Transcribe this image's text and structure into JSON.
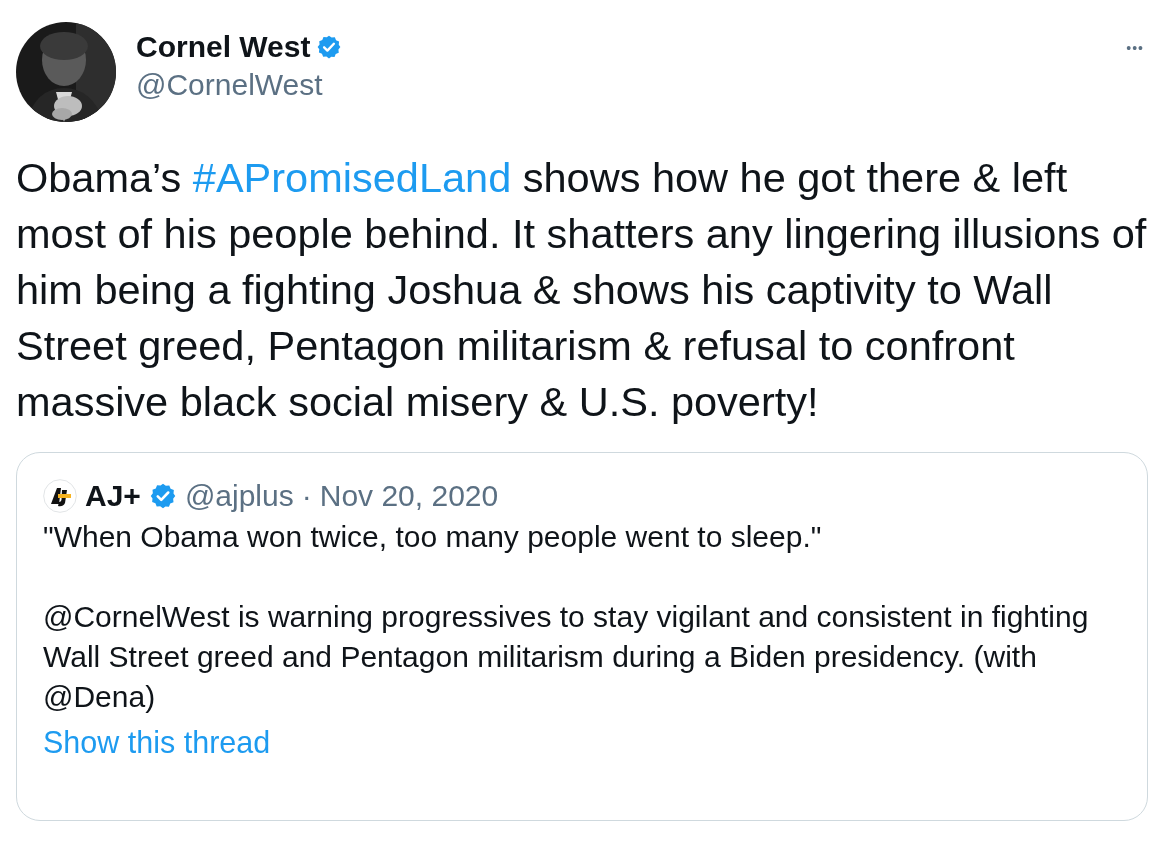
{
  "author": {
    "name": "Cornel West",
    "verified": true,
    "handle": "@CornelWest"
  },
  "more_button": "•••",
  "text": [
    {
      "kind": "text",
      "text": "Obama’s "
    },
    {
      "kind": "hashtag",
      "text": "#APromisedLand"
    },
    {
      "kind": "text",
      "text": " shows how he got there & left most of his people behind. It shatters any lingering illusions of him being a fighting Joshua & shows his captivity to Wall Street greed, Pentagon militarism & refusal to confront massive black social misery & U.S. poverty!"
    }
  ],
  "quoted_tweet": {
    "author": {
      "name": "AJ+",
      "verified": true,
      "handle": "@ajplus"
    },
    "separator": "·",
    "date": "Nov 20, 2020",
    "paragraphs": [
      "\"When Obama won twice, too many people went to sleep.\"",
      "@CornelWest is warning progressives to stay vigilant and consistent in fighting Wall Street greed and Pentagon militarism during a Biden presidency. (with @Dena)"
    ],
    "show_thread": "Show this thread"
  }
}
